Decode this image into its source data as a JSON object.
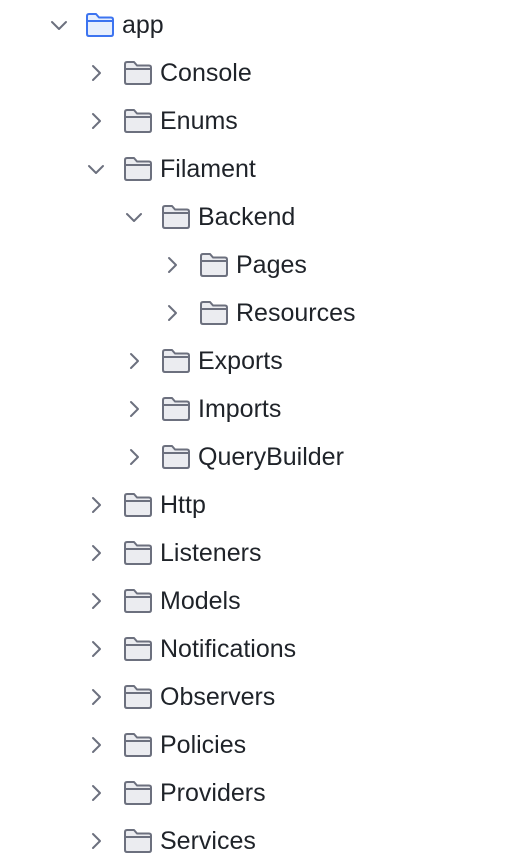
{
  "tree": {
    "items": [
      {
        "label": "app",
        "expanded": true,
        "icon": "folder-icon",
        "accent": "#3d74f0"
      },
      {
        "label": "Console",
        "expanded": false,
        "icon": "folder-icon"
      },
      {
        "label": "Enums",
        "expanded": false,
        "icon": "folder-icon"
      },
      {
        "label": "Filament",
        "expanded": true,
        "icon": "folder-icon"
      },
      {
        "label": "Backend",
        "expanded": true,
        "icon": "folder-icon"
      },
      {
        "label": "Pages",
        "expanded": false,
        "icon": "folder-icon"
      },
      {
        "label": "Resources",
        "expanded": false,
        "icon": "folder-icon"
      },
      {
        "label": "Exports",
        "expanded": false,
        "icon": "folder-icon"
      },
      {
        "label": "Imports",
        "expanded": false,
        "icon": "folder-icon"
      },
      {
        "label": "QueryBuilder",
        "expanded": false,
        "icon": "folder-icon"
      },
      {
        "label": "Http",
        "expanded": false,
        "icon": "folder-icon"
      },
      {
        "label": "Listeners",
        "expanded": false,
        "icon": "folder-icon"
      },
      {
        "label": "Models",
        "expanded": false,
        "icon": "folder-icon"
      },
      {
        "label": "Notifications",
        "expanded": false,
        "icon": "folder-icon"
      },
      {
        "label": "Observers",
        "expanded": false,
        "icon": "folder-icon"
      },
      {
        "label": "Policies",
        "expanded": false,
        "icon": "folder-icon"
      },
      {
        "label": "Providers",
        "expanded": false,
        "icon": "folder-icon"
      },
      {
        "label": "Services",
        "expanded": false,
        "icon": "folder-icon"
      }
    ]
  },
  "colors": {
    "text": "#1f2329",
    "chevron": "#6c707e",
    "folder_stroke": "#6c707e",
    "folder_fill": "#ebecf0",
    "root_folder_stroke": "#3d74f0",
    "root_folder_fill": "#e7effd"
  }
}
